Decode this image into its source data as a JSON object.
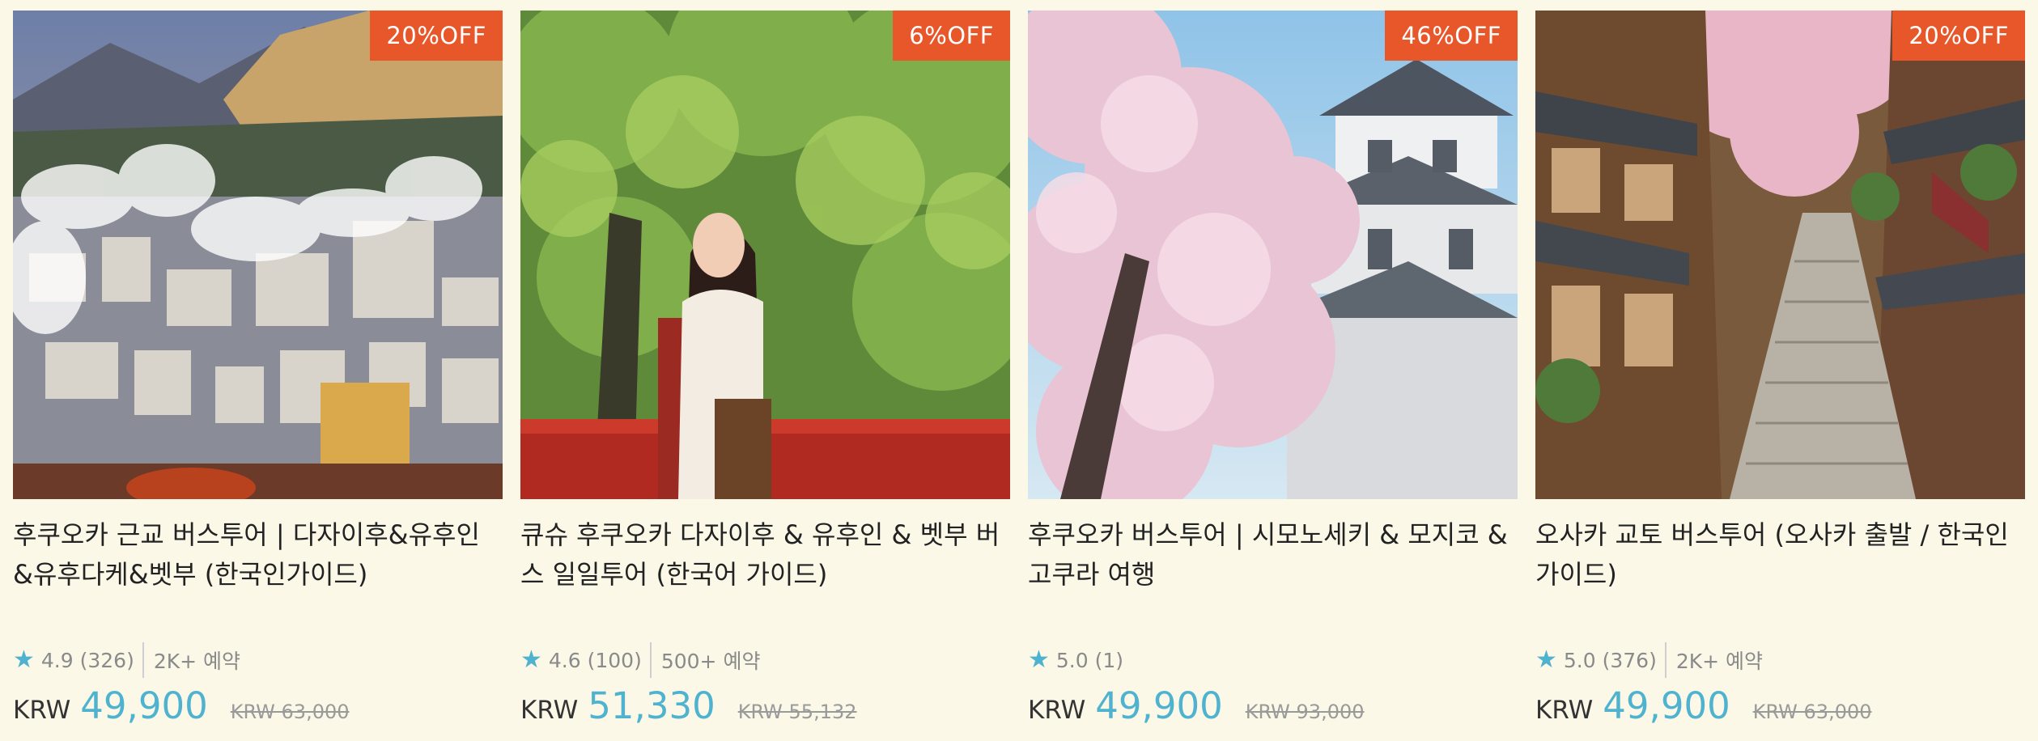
{
  "cards": [
    {
      "image_alt": "Beppu hot spring town with steam rising",
      "discount": "20%OFF",
      "title": "후쿠오카 근교 버스투어 | 다자이후&유후인&유후다케&벳부 (한국인가이드)",
      "rating": "4.9 (326)",
      "bookings": "2K+ 예약",
      "currency": "KRW",
      "price": "49,900",
      "original_price": "KRW 63,000"
    },
    {
      "image_alt": "Smiling woman on a red bridge among green trees",
      "discount": "6%OFF",
      "title": "큐슈 후쿠오카 다자이후 & 유후인 & 벳부 버스 일일투어 (한국어 가이드)",
      "rating": "4.6 (100)",
      "bookings": "500+ 예약",
      "currency": "KRW",
      "price": "51,330",
      "original_price": "KRW 55,132"
    },
    {
      "image_alt": "Cherry blossoms in front of a Japanese castle",
      "discount": "46%OFF",
      "title": "후쿠오카 버스투어 | 시모노세키 & 모지코 & 고쿠라 여행",
      "rating": "5.0 (1)",
      "bookings": "",
      "currency": "KRW",
      "price": "49,900",
      "original_price": "KRW 93,000"
    },
    {
      "image_alt": "Traditional Kyoto street with stone steps and wooden houses",
      "discount": "20%OFF",
      "title": "오사카 교토 버스투어 (오사카 출발 / 한국인가이드)",
      "rating": "5.0 (376)",
      "bookings": "2K+ 예약",
      "currency": "KRW",
      "price": "49,900",
      "original_price": "KRW 63,000"
    }
  ],
  "colors": {
    "background": "#fbf8e8",
    "badge": "#e8572a",
    "accent": "#4fb3cf",
    "text": "#222222",
    "muted": "#8a8a8a"
  },
  "icons": {
    "rating": "star-icon"
  }
}
